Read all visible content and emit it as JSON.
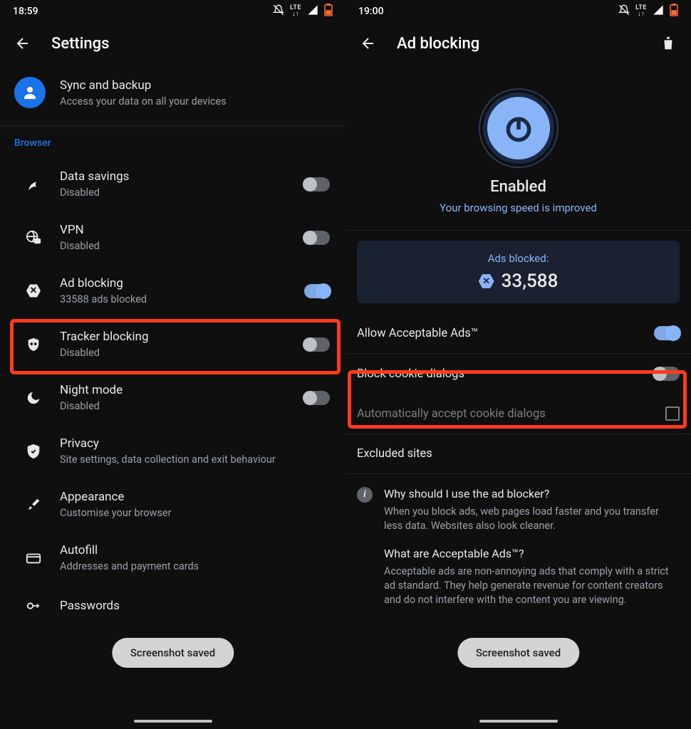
{
  "left": {
    "statusbar": {
      "time": "18:59",
      "network": "LTE"
    },
    "title": "Settings",
    "sync": {
      "title": "Sync and backup",
      "subtitle": "Access your data on all your devices"
    },
    "section": "Browser",
    "items": [
      {
        "title": "Data savings",
        "subtitle": "Disabled",
        "toggle": "off"
      },
      {
        "title": "VPN",
        "subtitle": "Disabled",
        "toggle": "off"
      },
      {
        "title": "Ad blocking",
        "subtitle": "33588 ads blocked",
        "toggle": "on"
      },
      {
        "title": "Tracker blocking",
        "subtitle": "Disabled",
        "toggle": "off"
      },
      {
        "title": "Night mode",
        "subtitle": "Disabled",
        "toggle": "off"
      },
      {
        "title": "Privacy",
        "subtitle": "Site settings, data collection and exit behaviour"
      },
      {
        "title": "Appearance",
        "subtitle": "Customise your browser"
      },
      {
        "title": "Autofill",
        "subtitle": "Addresses and payment cards"
      },
      {
        "title": "Passwords",
        "subtitle": ""
      }
    ],
    "toast": "Screenshot saved"
  },
  "right": {
    "statusbar": {
      "time": "19:00",
      "network": "LTE"
    },
    "title": "Ad blocking",
    "power": {
      "status": "Enabled",
      "subtitle": "Your browsing speed is improved"
    },
    "stats": {
      "label": "Ads blocked:",
      "count": "33,588"
    },
    "options": {
      "acceptable": "Allow Acceptable Ads™",
      "cookies": "Block cookie dialogs",
      "autoaccept": "Automatically accept cookie dialogs",
      "excluded": "Excluded sites"
    },
    "info": {
      "q1": "Why should I use the ad blocker?",
      "a1": "When you block ads, web pages load faster and you transfer less data. Websites also look cleaner.",
      "q2": "What are Acceptable Ads™?",
      "a2": "Acceptable ads are non-annoying ads that comply with a strict ad standard. They help generate revenue for content creators and do not interfere with the content you are viewing."
    },
    "toast": "Screenshot saved"
  }
}
